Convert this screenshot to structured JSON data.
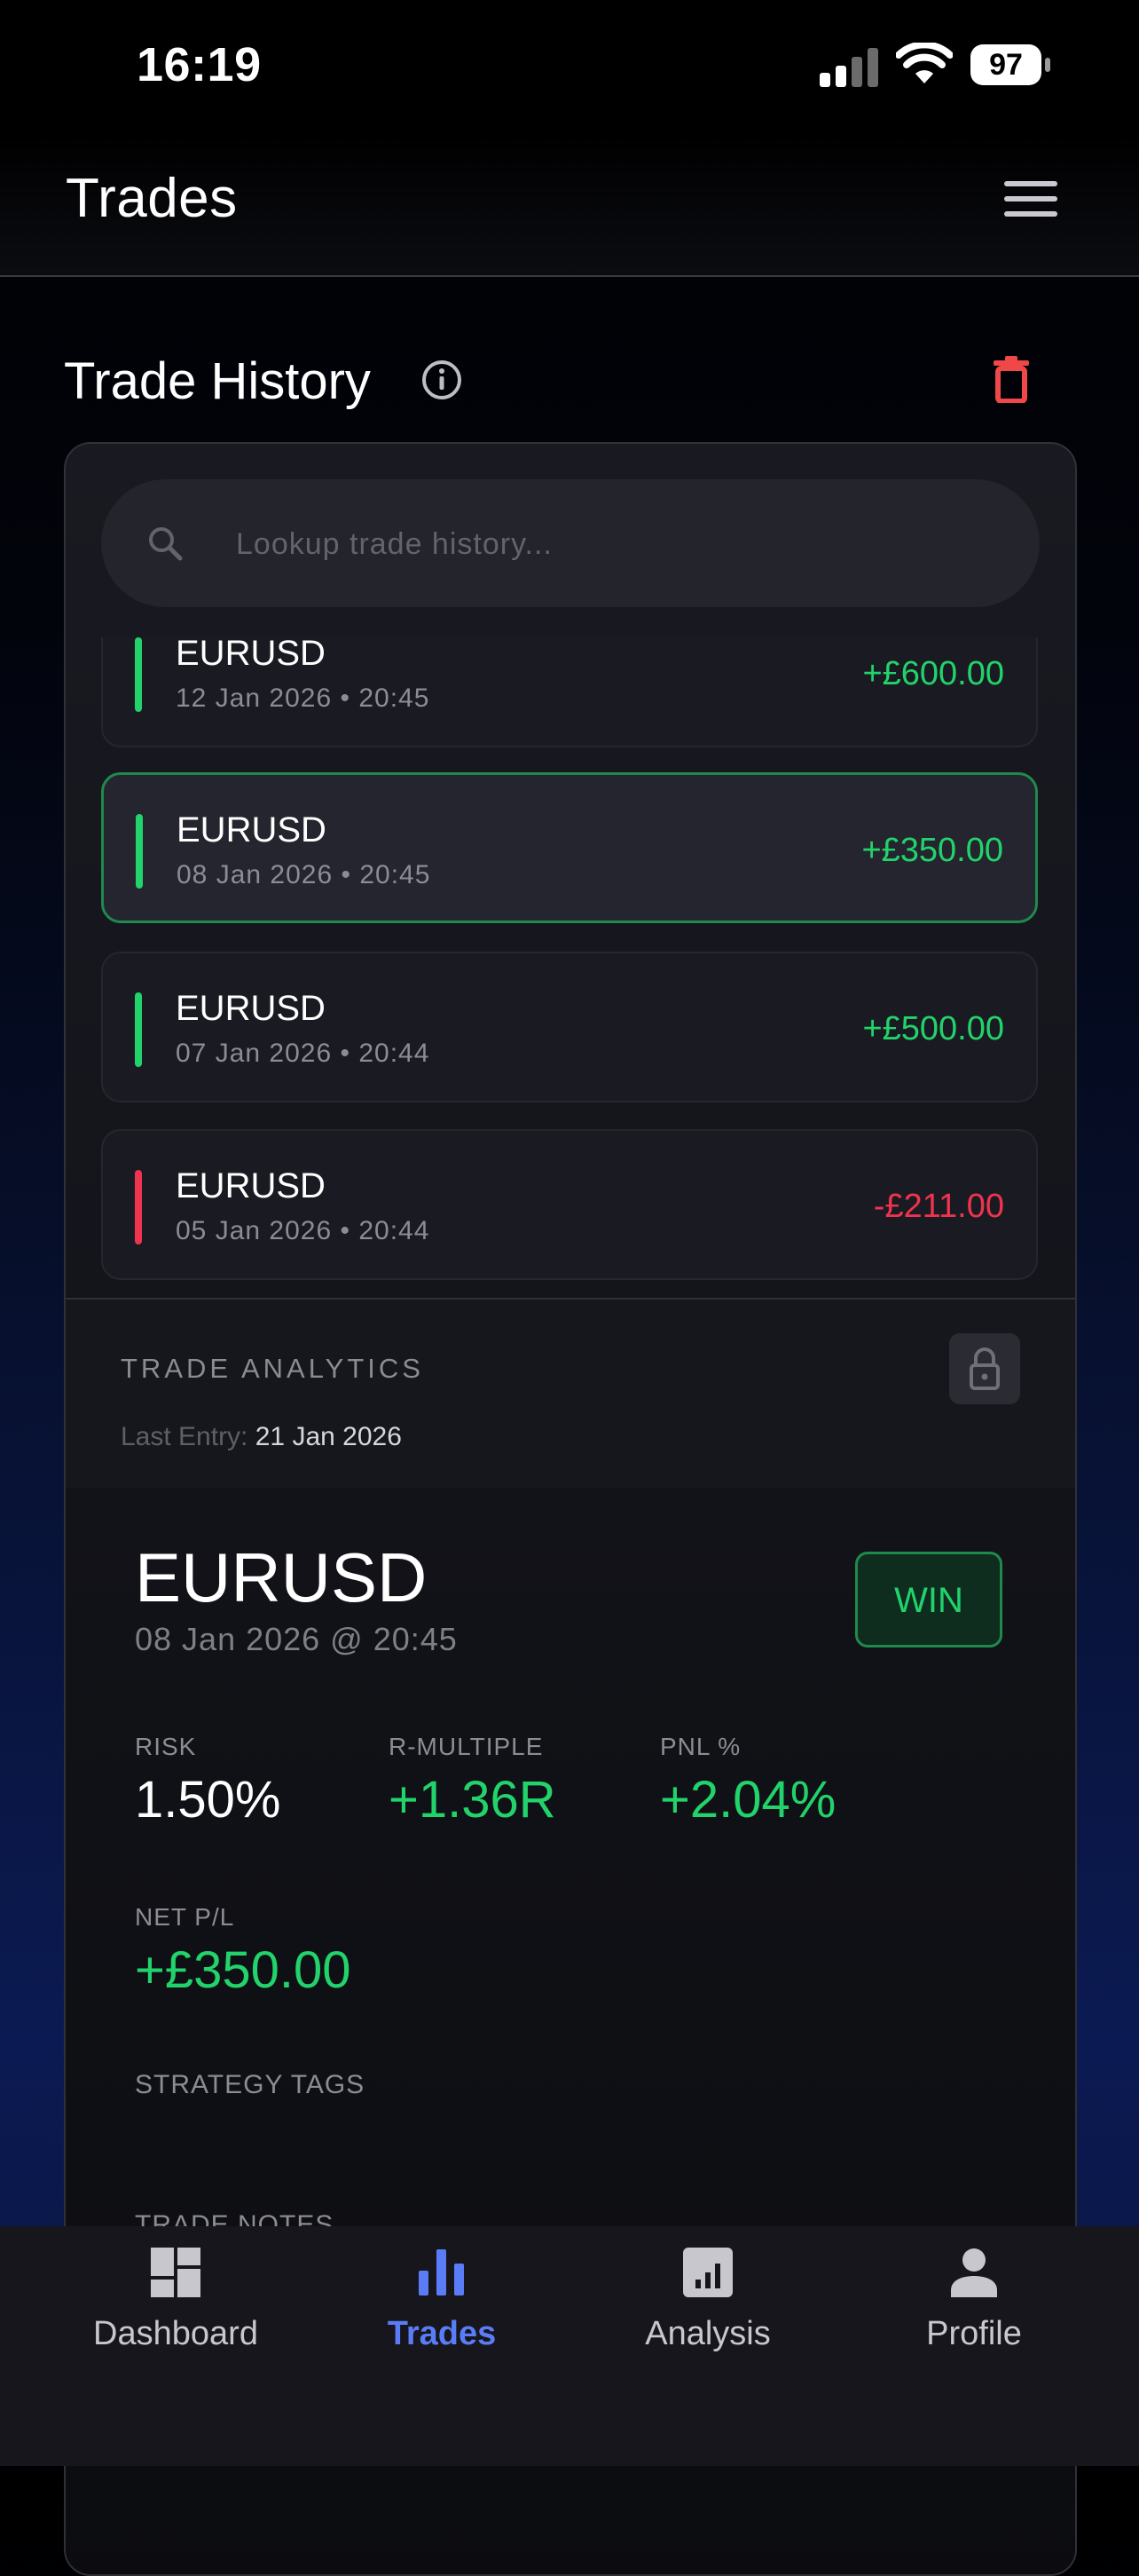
{
  "status_bar": {
    "time": "16:19",
    "battery": "97"
  },
  "header": {
    "title": "Trades"
  },
  "section": {
    "title": "Trade History"
  },
  "search": {
    "placeholder": "Lookup trade history..."
  },
  "trades": [
    {
      "symbol": "EURUSD",
      "date": "12 Jan 2026 • 20:45",
      "pnl": "+£600.00",
      "result": "win"
    },
    {
      "symbol": "EURUSD",
      "date": "08 Jan 2026 • 20:45",
      "pnl": "+£350.00",
      "result": "win",
      "selected": true
    },
    {
      "symbol": "EURUSD",
      "date": "07 Jan 2026 • 20:44",
      "pnl": "+£500.00",
      "result": "win"
    },
    {
      "symbol": "EURUSD",
      "date": "05 Jan 2026 • 20:44",
      "pnl": "-£211.00",
      "result": "loss"
    }
  ],
  "analytics": {
    "heading": "TRADE ANALYTICS",
    "last_entry_label": "Last Entry:",
    "last_entry_value": "21 Jan 2026"
  },
  "detail": {
    "symbol": "EURUSD",
    "date": "08 Jan 2026 @ 20:45",
    "badge": "WIN",
    "risk_label": "RISK",
    "risk_value": "1.50%",
    "r_label": "R-MULTIPLE",
    "r_value": "+1.36R",
    "pnl_pct_label": "PNL %",
    "pnl_pct_value": "+2.04%",
    "net_label": "NET P/L",
    "net_value": "+£350.00",
    "tags_label": "STRATEGY TAGS",
    "notes_label": "TRADE NOTES"
  },
  "tabs": [
    {
      "label": "Dashboard",
      "icon": "dashboard-icon"
    },
    {
      "label": "Trades",
      "icon": "bar-chart-icon",
      "active": true
    },
    {
      "label": "Analysis",
      "icon": "analysis-icon"
    },
    {
      "label": "Profile",
      "icon": "person-icon"
    }
  ],
  "colors": {
    "profit": "#22d36b",
    "loss": "#f0334e",
    "accent": "#5b7cf7",
    "delete": "#f04848"
  }
}
